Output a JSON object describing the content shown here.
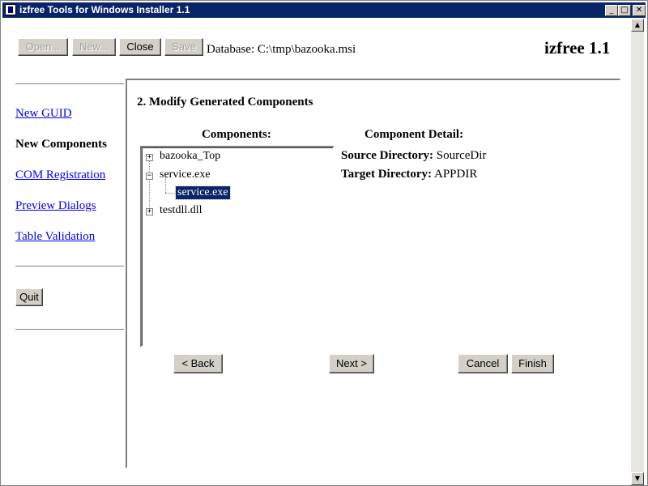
{
  "window": {
    "title": "izfree Tools for Windows Installer 1.1"
  },
  "titlebar_buttons": {
    "minimize": "_",
    "maximize": "□",
    "close": "✕"
  },
  "toolbar": {
    "open_label": "Open...",
    "new_label": "New...",
    "close_label": "Close",
    "save_label": "Save",
    "database_text": "Database: C:\\tmp\\bazooka.msi",
    "version": "izfree 1.1"
  },
  "nav": {
    "items": [
      {
        "label": "New GUID",
        "state": "link"
      },
      {
        "label": "New Components",
        "state": "current"
      },
      {
        "label": "COM Registration",
        "state": "link"
      },
      {
        "label": "Preview Dialogs",
        "state": "link"
      },
      {
        "label": "Table Validation",
        "state": "link"
      }
    ],
    "quit_label": "Quit"
  },
  "main": {
    "step_title": "2. Modify Generated Components",
    "components_heading": "Components:",
    "detail_heading": "Component Detail:",
    "tree": [
      {
        "label": "bazooka_Top",
        "expander": "+"
      },
      {
        "label": "service.exe",
        "expander": "−"
      },
      {
        "label": "service.exe",
        "selected": true
      },
      {
        "label": "testdll.dll",
        "expander": "+"
      }
    ],
    "detail": {
      "source_label": "Source Directory:",
      "source_value": "SourceDir",
      "target_label": "Target Directory:",
      "target_value": "APPDIR"
    },
    "buttons": {
      "back_label": "< Back",
      "next_label": "Next >",
      "cancel_label": "Cancel",
      "finish_label": "Finish"
    }
  },
  "scrollbar": {
    "up_arrow": "▲",
    "down_arrow": "▼"
  },
  "colors": {
    "titlebar": "#0a246a",
    "link": "#0000ee",
    "selection": "#0a246a"
  }
}
